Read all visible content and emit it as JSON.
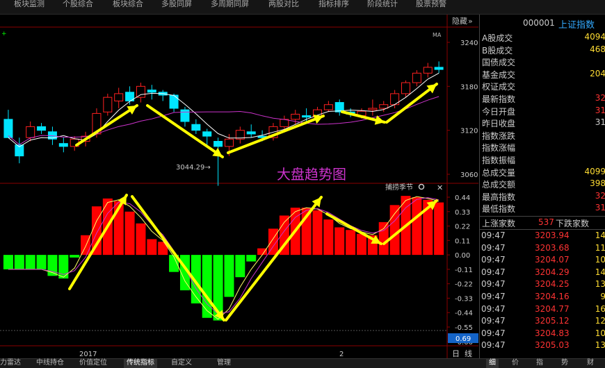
{
  "top_tabs": [
    "板块监测",
    "个股综合",
    "板块综合",
    "多股同屏",
    "多周期同屏",
    "两股对比",
    "指标排序",
    "阶段统计",
    "股票预警"
  ],
  "chart": {
    "ma_label": "MA",
    "hide_label": "隐藏",
    "hide_arrow": "»",
    "price_ticks": [
      "3240",
      "3180",
      "3120",
      "3060"
    ],
    "low_marker": "3044.29→",
    "annotation_title": "大盘趋势图",
    "indicator_name": "捕捞季节",
    "close_icon": "✕",
    "macd_ticks": [
      "0.44",
      "0.33",
      "0.22",
      "0.11",
      "0.00",
      "-0.11",
      "-0.22",
      "-0.33",
      "-0.44",
      "-0.55",
      "-0.66"
    ],
    "current_value": "0.69",
    "xaxis": [
      "2017",
      "2"
    ],
    "period_day": "日",
    "period_line": "线",
    "colors": {
      "up": "#ff2020",
      "down": "#00e5ff",
      "macd_up": "#ff0000",
      "macd_down": "#00ff00",
      "arrow": "#ffff00",
      "ma": "#cc33cc",
      "title": "#cc33cc"
    }
  },
  "chart_data": {
    "type": "candlestick+histogram",
    "price_ylim": [
      3020,
      3260
    ],
    "candles": [
      {
        "o": 3135,
        "h": 3148,
        "l": 3120,
        "c": 3110
      },
      {
        "o": 3100,
        "h": 3110,
        "l": 3075,
        "c": 3085
      },
      {
        "o": 3110,
        "h": 3132,
        "l": 3105,
        "c": 3125
      },
      {
        "o": 3125,
        "h": 3130,
        "l": 3115,
        "c": 3120
      },
      {
        "o": 3118,
        "h": 3125,
        "l": 3100,
        "c": 3108
      },
      {
        "o": 3102,
        "h": 3110,
        "l": 3090,
        "c": 3098
      },
      {
        "o": 3098,
        "h": 3112,
        "l": 3092,
        "c": 3108
      },
      {
        "o": 3105,
        "h": 3118,
        "l": 3098,
        "c": 3112
      },
      {
        "o": 3115,
        "h": 3150,
        "l": 3110,
        "c": 3143
      },
      {
        "o": 3145,
        "h": 3170,
        "l": 3140,
        "c": 3165
      },
      {
        "o": 3160,
        "h": 3178,
        "l": 3150,
        "c": 3170
      },
      {
        "o": 3172,
        "h": 3180,
        "l": 3155,
        "c": 3160
      },
      {
        "o": 3165,
        "h": 3185,
        "l": 3158,
        "c": 3180
      },
      {
        "o": 3175,
        "h": 3182,
        "l": 3162,
        "c": 3172
      },
      {
        "o": 3172,
        "h": 3175,
        "l": 3160,
        "c": 3168
      },
      {
        "o": 3168,
        "h": 3170,
        "l": 3145,
        "c": 3150
      },
      {
        "o": 3148,
        "h": 3152,
        "l": 3125,
        "c": 3132
      },
      {
        "o": 3128,
        "h": 3135,
        "l": 3115,
        "c": 3120
      },
      {
        "o": 3118,
        "h": 3122,
        "l": 3100,
        "c": 3112
      },
      {
        "o": 3105,
        "h": 3110,
        "l": 3044.29,
        "c": 3098
      },
      {
        "o": 3098,
        "h": 3115,
        "l": 3085,
        "c": 3108
      },
      {
        "o": 3108,
        "h": 3125,
        "l": 3102,
        "c": 3120
      },
      {
        "o": 3118,
        "h": 3128,
        "l": 3110,
        "c": 3115
      },
      {
        "o": 3112,
        "h": 3120,
        "l": 3105,
        "c": 3110
      },
      {
        "o": 3110,
        "h": 3130,
        "l": 3106,
        "c": 3125
      },
      {
        "o": 3125,
        "h": 3140,
        "l": 3120,
        "c": 3135
      },
      {
        "o": 3135,
        "h": 3148,
        "l": 3128,
        "c": 3142
      },
      {
        "o": 3140,
        "h": 3150,
        "l": 3132,
        "c": 3138
      },
      {
        "o": 3138,
        "h": 3152,
        "l": 3135,
        "c": 3148
      },
      {
        "o": 3148,
        "h": 3160,
        "l": 3145,
        "c": 3155
      },
      {
        "o": 3158,
        "h": 3162,
        "l": 3140,
        "c": 3145
      },
      {
        "o": 3145,
        "h": 3150,
        "l": 3138,
        "c": 3142
      },
      {
        "o": 3140,
        "h": 3150,
        "l": 3136,
        "c": 3146
      },
      {
        "o": 3148,
        "h": 3162,
        "l": 3140,
        "c": 3150
      },
      {
        "o": 3150,
        "h": 3160,
        "l": 3145,
        "c": 3155
      },
      {
        "o": 3155,
        "h": 3175,
        "l": 3150,
        "c": 3170
      },
      {
        "o": 3170,
        "h": 3188,
        "l": 3165,
        "c": 3185
      },
      {
        "o": 3185,
        "h": 3202,
        "l": 3180,
        "c": 3198
      },
      {
        "o": 3198,
        "h": 3212,
        "l": 3192,
        "c": 3206
      },
      {
        "o": 3206,
        "h": 3214,
        "l": 3198,
        "c": 3203
      }
    ],
    "macd_ylim": [
      -0.66,
      0.5
    ],
    "macd": [
      -0.11,
      -0.11,
      -0.11,
      -0.11,
      -0.16,
      -0.18,
      -0.02,
      0.15,
      0.37,
      0.43,
      0.41,
      0.33,
      0.24,
      0.12,
      0.1,
      -0.13,
      -0.27,
      -0.37,
      -0.48,
      -0.5,
      -0.32,
      -0.17,
      -0.05,
      0.05,
      0.2,
      0.3,
      0.36,
      0.36,
      0.34,
      0.27,
      0.21,
      0.19,
      0.16,
      0.15,
      0.25,
      0.38,
      0.45,
      0.44,
      0.42,
      0.4
    ]
  },
  "panel": {
    "code": "000001",
    "name": "上证指数",
    "rows": [
      {
        "k": "A股成交",
        "v": "4094",
        "c": "#ffdd33"
      },
      {
        "k": "B股成交",
        "v": "468",
        "c": "#ffdd33"
      },
      {
        "k": "国债成交",
        "v": "",
        "c": "#ffdd33"
      },
      {
        "k": "基金成交",
        "v": "204",
        "c": "#ffdd33"
      },
      {
        "k": "权证成交",
        "v": "",
        "c": "#ffdd33"
      },
      {
        "k": "最新指数",
        "v": "32",
        "c": "#ff3333"
      },
      {
        "k": "今日开盘",
        "v": "31",
        "c": "#ff3333"
      },
      {
        "k": "昨日收盘",
        "v": "31",
        "c": "#cccccc"
      },
      {
        "k": "指数涨跌",
        "v": "",
        "c": "#ff3333"
      },
      {
        "k": "指数涨幅",
        "v": "",
        "c": "#ff3333"
      },
      {
        "k": "指数振幅",
        "v": "",
        "c": "#ff3333"
      },
      {
        "k": "总成交量",
        "v": "4099",
        "c": "#ffdd33"
      },
      {
        "k": "总成交额",
        "v": "398",
        "c": "#ffdd33"
      },
      {
        "k": "最高指数",
        "v": "32",
        "c": "#ff3333"
      },
      {
        "k": "最低指数",
        "v": "31",
        "c": "#ff3333"
      }
    ],
    "updown": {
      "up_label": "上涨家数",
      "up": "537",
      "down_label": "下跌家数"
    },
    "ticks": [
      {
        "t": "09:47",
        "p": "3203.94",
        "v": "14"
      },
      {
        "t": "09:47",
        "p": "3203.68",
        "v": "11"
      },
      {
        "t": "09:47",
        "p": "3204.07",
        "v": "10"
      },
      {
        "t": "09:47",
        "p": "3204.29",
        "v": "14"
      },
      {
        "t": "09:47",
        "p": "3204.25",
        "v": "13"
      },
      {
        "t": "09:47",
        "p": "3204.16",
        "v": "9"
      },
      {
        "t": "09:47",
        "p": "3204.77",
        "v": "16"
      },
      {
        "t": "09:47",
        "p": "3205.12",
        "v": "12"
      },
      {
        "t": "09:47",
        "p": "3204.83",
        "v": "10"
      },
      {
        "t": "09:47",
        "p": "3205.03",
        "v": "13"
      }
    ]
  },
  "bottom_tabs": [
    "力雷达",
    "中线持仓",
    "价值定位",
    "传统指标",
    "自定义",
    "管理"
  ],
  "side_tabs": [
    "细",
    "价",
    "指",
    "势",
    "财"
  ]
}
